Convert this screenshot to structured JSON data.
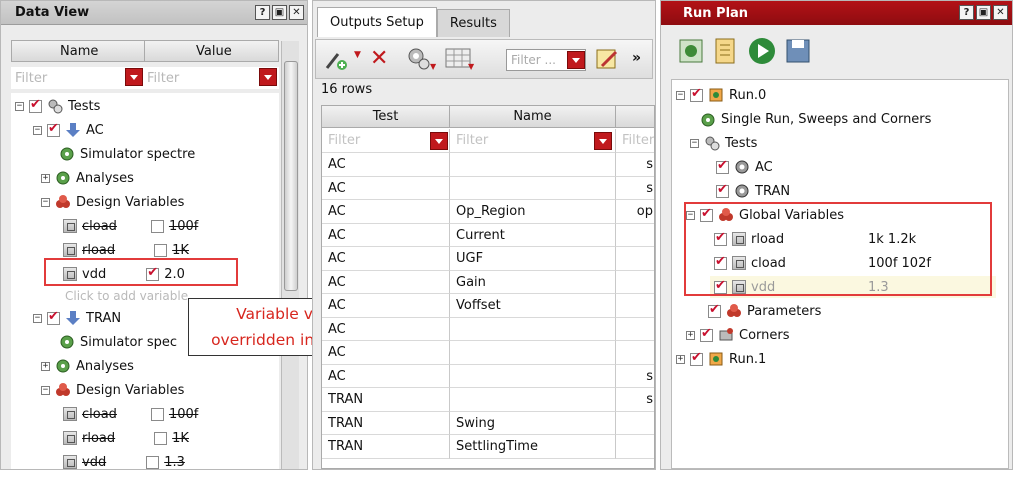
{
  "data_view": {
    "title": "Data View",
    "col_name": "Name",
    "col_value": "Value",
    "filter_placeholder": "Filter",
    "tree": {
      "tests": "Tests",
      "ac": "AC",
      "simulator": "Simulator spectre",
      "analyses": "Analyses",
      "design_variables": "Design Variables",
      "cload": "cload",
      "cload_val": "100f",
      "rload": "rload",
      "rload_val": "1K",
      "vdd": "vdd",
      "vdd_val_ac": "2.0",
      "click_add": "Click to add variable",
      "tran": "TRAN",
      "simulator_tran": "Simulator spec",
      "vdd_val_tran": "1.3"
    }
  },
  "callout": {
    "line1": "Variable vdd is",
    "line2": "overridden in test AC"
  },
  "outputs": {
    "tab_outputs": "Outputs Setup",
    "tab_results": "Results",
    "filter_placeholder": "Filter ...",
    "rows_count": "16 rows",
    "col_test": "Test",
    "col_name": "Name",
    "col_filter": "Filter",
    "rows": [
      {
        "test": "AC",
        "name": "",
        "c3": "s"
      },
      {
        "test": "AC",
        "name": "",
        "c3": "s"
      },
      {
        "test": "AC",
        "name": "Op_Region",
        "c3": "op"
      },
      {
        "test": "AC",
        "name": "Current",
        "c3": ""
      },
      {
        "test": "AC",
        "name": "UGF",
        "c3": ""
      },
      {
        "test": "AC",
        "name": "Gain",
        "c3": ""
      },
      {
        "test": "AC",
        "name": "Voffset",
        "c3": ""
      },
      {
        "test": "AC",
        "name": "",
        "c3": ""
      },
      {
        "test": "AC",
        "name": "",
        "c3": ""
      },
      {
        "test": "AC",
        "name": "",
        "c3": "s"
      },
      {
        "test": "TRAN",
        "name": "",
        "c3": "s"
      },
      {
        "test": "TRAN",
        "name": "Swing",
        "c3": ""
      },
      {
        "test": "TRAN",
        "name": "SettlingTime",
        "c3": ""
      }
    ]
  },
  "run_plan": {
    "title": "Run Plan",
    "run0": "Run.0",
    "single_run": "Single Run, Sweeps and Corners",
    "tests": "Tests",
    "ac": "AC",
    "tran": "TRAN",
    "global_vars": "Global Variables",
    "rload": "rload",
    "rload_val": "1k 1.2k",
    "cload": "cload",
    "cload_val": "100f 102f",
    "vdd": "vdd",
    "vdd_val": "1.3",
    "parameters": "Parameters",
    "corners": "Corners",
    "run1": "Run.1"
  },
  "colors": {
    "accent_red": "#c0191d",
    "callout_red": "#e23b3b"
  }
}
